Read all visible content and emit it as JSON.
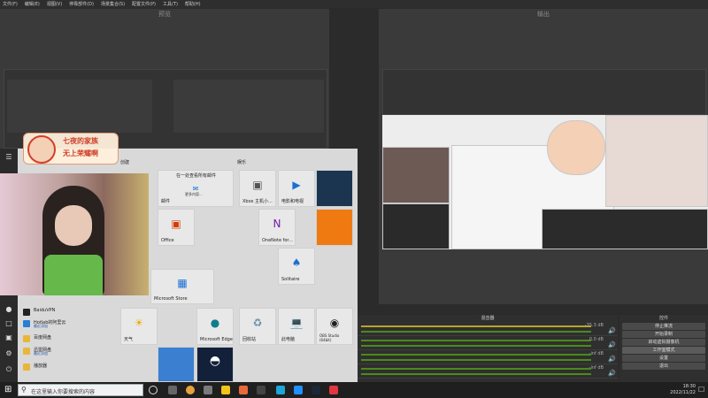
{
  "menubar": {
    "items": [
      "文件(F)",
      "编辑(E)",
      "视图(V)",
      "停靠部件(D)",
      "场景集合(S)",
      "配置文件(P)",
      "工具(T)",
      "帮助(H)"
    ]
  },
  "preview": {
    "title": "预览"
  },
  "program": {
    "title": "输出"
  },
  "overlay": {
    "banner_line1": "七夜的家族",
    "banner_line2": "无上荣耀啊"
  },
  "startmenu": {
    "group_create": "创建",
    "group_play": "娱乐",
    "apps": [
      {
        "name": "BaiduVPN",
        "sub": ""
      },
      {
        "name": "Hotlab的阿里云",
        "sub": "最近添加"
      },
      {
        "name": "百度网盘",
        "sub": ""
      },
      {
        "name": "迅雷网盘",
        "sub": "最近添加"
      },
      {
        "name": "播放器",
        "sub": ""
      }
    ],
    "tiles": {
      "mail_banner": "在一处查看所有邮件",
      "mail_sub": "更多内容...",
      "mail": "邮件",
      "xbox": "Xbox 主机小...",
      "movies": "电影和电视",
      "office": "Office",
      "onenote": "OneNote for...",
      "solitaire": "Solitaire",
      "store": "Microsoft Store",
      "weather": "天气",
      "edge": "Microsoft Edge",
      "recycle": "回收站",
      "pc": "此电脑",
      "obs": "OBS Studio (64bit)"
    }
  },
  "mixer": {
    "title": "混音器",
    "rows": [
      {
        "vol": "-35.3 dB"
      },
      {
        "vol": "0.0 dB"
      },
      {
        "vol": "-inf dB"
      },
      {
        "vol": "-inf dB"
      }
    ]
  },
  "controls": {
    "title": "控件",
    "buttons": [
      "停止推流",
      "开始录制",
      "启动虚拟摄像机",
      "工作室模式",
      "设置",
      "退出"
    ]
  },
  "taskbar": {
    "search_placeholder": "在这里输入你要搜索的内容",
    "time": "18:30",
    "date": "2022/11/22"
  },
  "colors": {
    "obs_bg": "#2b2b2b",
    "meter_green": "#4c8a1a",
    "meter_yellow": "#b9a52a",
    "accent_red": "#d2402a"
  }
}
